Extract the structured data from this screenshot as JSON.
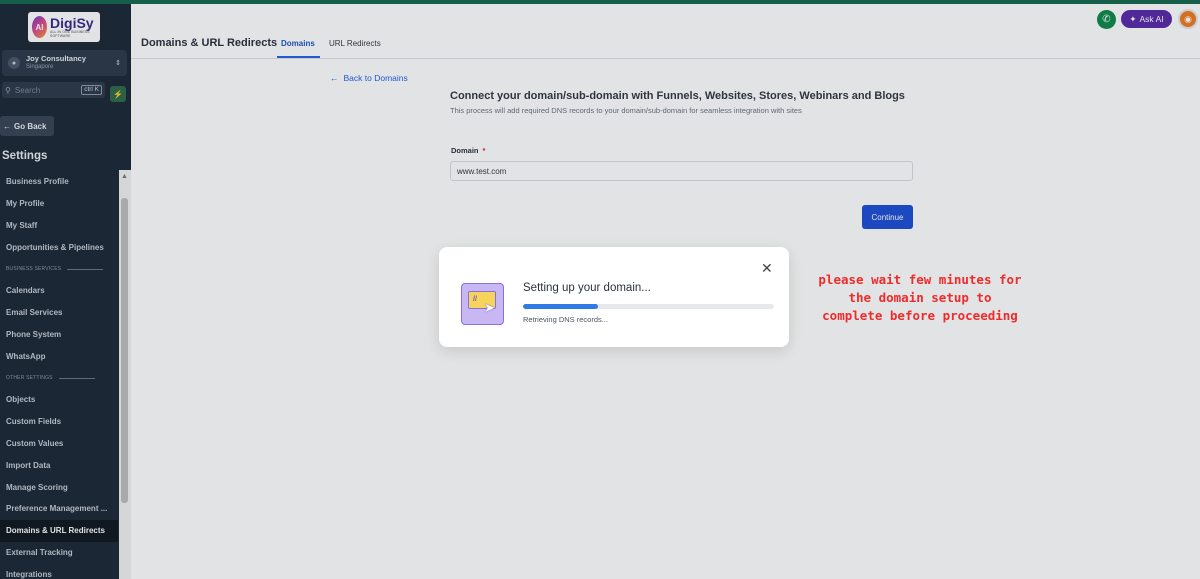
{
  "sidebar": {
    "logo": {
      "name": "DigiSy",
      "tagline": "ALL IN ONE BUSINESS SOFTWARE"
    },
    "account": {
      "name": "Joy Consultancy",
      "location": "Singapore"
    },
    "search": {
      "label": "Search",
      "shortcut": "ctrl K"
    },
    "go_back": "Go Back",
    "settings_title": "Settings",
    "items": [
      {
        "label": "Business Profile"
      },
      {
        "label": "My Profile"
      },
      {
        "label": "My Staff"
      },
      {
        "label": "Opportunities & Pipelines"
      },
      {
        "section": "BUSINESS SERVICES"
      },
      {
        "label": "Calendars"
      },
      {
        "label": "Email Services"
      },
      {
        "label": "Phone System"
      },
      {
        "label": "WhatsApp"
      },
      {
        "section": "OTHER SETTINGS"
      },
      {
        "label": "Objects"
      },
      {
        "label": "Custom Fields"
      },
      {
        "label": "Custom Values"
      },
      {
        "label": "Import Data"
      },
      {
        "label": "Manage Scoring"
      },
      {
        "label": "Preference Management ..."
      },
      {
        "label": "Domains & URL Redirects",
        "active": true
      },
      {
        "label": "External Tracking"
      },
      {
        "label": "Integrations"
      }
    ]
  },
  "header": {
    "title": "Domains & URL Redirects",
    "tabs": [
      {
        "label": "Domains",
        "active": true
      },
      {
        "label": "URL Redirects"
      }
    ],
    "ask_ai": "Ask AI"
  },
  "main": {
    "back_link": "Back to Domains",
    "heading": "Connect your domain/sub-domain with Funnels, Websites, Stores, Webinars and Blogs",
    "subheading": "This process will add required DNS records to your domain/sub-domain for seamless integration with sites",
    "domain_label": "Domain",
    "required_marker": "*",
    "domain_value": "www.test.com",
    "continue_label": "Continue"
  },
  "modal": {
    "title": "Setting up your domain...",
    "progress": 0.3,
    "status": "Retrieving DNS records..."
  },
  "annotation": {
    "lines": [
      "please wait few minutes for",
      "the domain setup to",
      "complete before proceeding"
    ]
  },
  "colors": {
    "sidebar_bg": "#1e2a38",
    "accent": "#2563eb",
    "continue_bg": "#1e4fd6",
    "ask_ai_bg": "#5a2ba8",
    "phone_bg": "#0f8a4c",
    "bell_bg": "#f07a21",
    "annotation": "#ef2b2b"
  },
  "icons": {
    "back": "arrow-left-icon",
    "close": "close-icon",
    "phone": "phone-icon",
    "bell": "bell-icon",
    "search": "search-icon",
    "sparkle": "sparkle-icon"
  }
}
